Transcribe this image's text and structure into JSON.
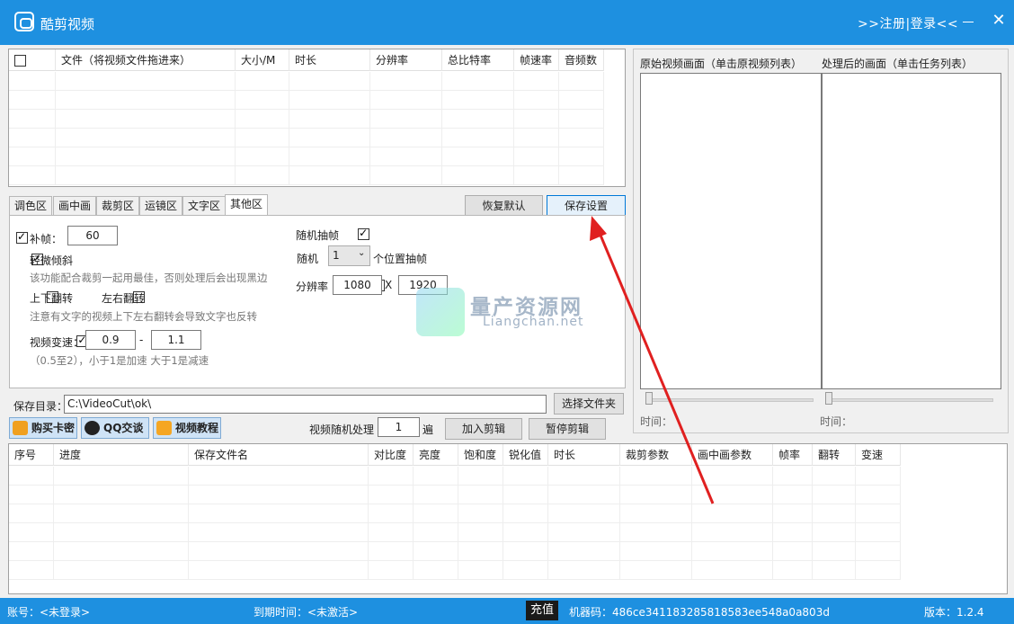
{
  "app": {
    "title": "酷剪视频",
    "login": ">>注册|登录<<"
  },
  "file_table": {
    "columns": [
      "文件（将视频文件拖进来）",
      "大小/M",
      "时长",
      "分辨率",
      "总比特率",
      "帧速率",
      "音频数"
    ],
    "rows": []
  },
  "tabs": [
    {
      "label": "调色区",
      "active": false
    },
    {
      "label": "画中画",
      "active": false
    },
    {
      "label": "裁剪区",
      "active": false
    },
    {
      "label": "运镜区",
      "active": false
    },
    {
      "label": "文字区",
      "active": false
    },
    {
      "label": "其他区",
      "active": true
    }
  ],
  "tab_buttons": {
    "restore_default": "恢复默认",
    "save_settings": "保存设置"
  },
  "other_panel": {
    "fill_frame": {
      "label": "补帧：",
      "checked": true,
      "value": "60"
    },
    "slight_tilt": {
      "label": "轻微倾斜",
      "checked": true,
      "hint": "该功能配合裁剪一起用最佳，否则处理后会出现黑边"
    },
    "flip_vertical": {
      "label": "上下翻转",
      "checked": false
    },
    "flip_horizontal": {
      "label": "左右翻转",
      "checked": false
    },
    "flip_hint": "注意有文字的视频上下左右翻转会导致文字也反转",
    "speed": {
      "label": "视频变速：",
      "checked": true,
      "min": "0.9",
      "max": "1.1",
      "separator": "-",
      "hint": "（0.5至2），小于1是加速 大于1是减速"
    },
    "random_drop": {
      "label": "随机抽帧",
      "checked": true,
      "random_label": "随机",
      "select_value": "1",
      "suffix": "个位置抽帧"
    },
    "resolution": {
      "label": "分辨率",
      "checked": false,
      "width": "1080",
      "x": "X",
      "height": "1920"
    }
  },
  "save_dir": {
    "label": "保存目录：",
    "value": "C:\\VideoCut\\ok\\",
    "button": "选择文件夹"
  },
  "toolbar": {
    "buy_card": "购买卡密",
    "qq_chat": "QQ交谈",
    "video_tutorial": "视频教程",
    "random_process_label": "视频随机处理",
    "random_process_value": "1",
    "random_process_unit": "遍",
    "add_edit": "加入剪辑",
    "pause_edit": "暂停剪辑"
  },
  "preview": {
    "original_label": "原始视频画面（单击原视频列表）",
    "processed_label": "处理后的画面（单击任务列表）",
    "time_label_left": "时间：",
    "time_label_right": "时间："
  },
  "task_table": {
    "columns": [
      "序号",
      "进度",
      "保存文件名",
      "对比度",
      "亮度",
      "饱和度",
      "锐化值",
      "时长",
      "裁剪参数",
      "画中画参数",
      "帧率",
      "翻转",
      "变速"
    ],
    "rows": []
  },
  "watermark": {
    "title": "量产资源网",
    "url": "Liangchan.net"
  },
  "status": {
    "account": "账号：<未登录>",
    "expiry": "到期时间：<未激活>",
    "recharge": "充值",
    "machine_code": "机器码：486ce341183285818583ee548a0a803d",
    "version": "版本：1.2.4"
  },
  "colors": {
    "accent": "#1e90e0",
    "arrow": "#e02020"
  }
}
